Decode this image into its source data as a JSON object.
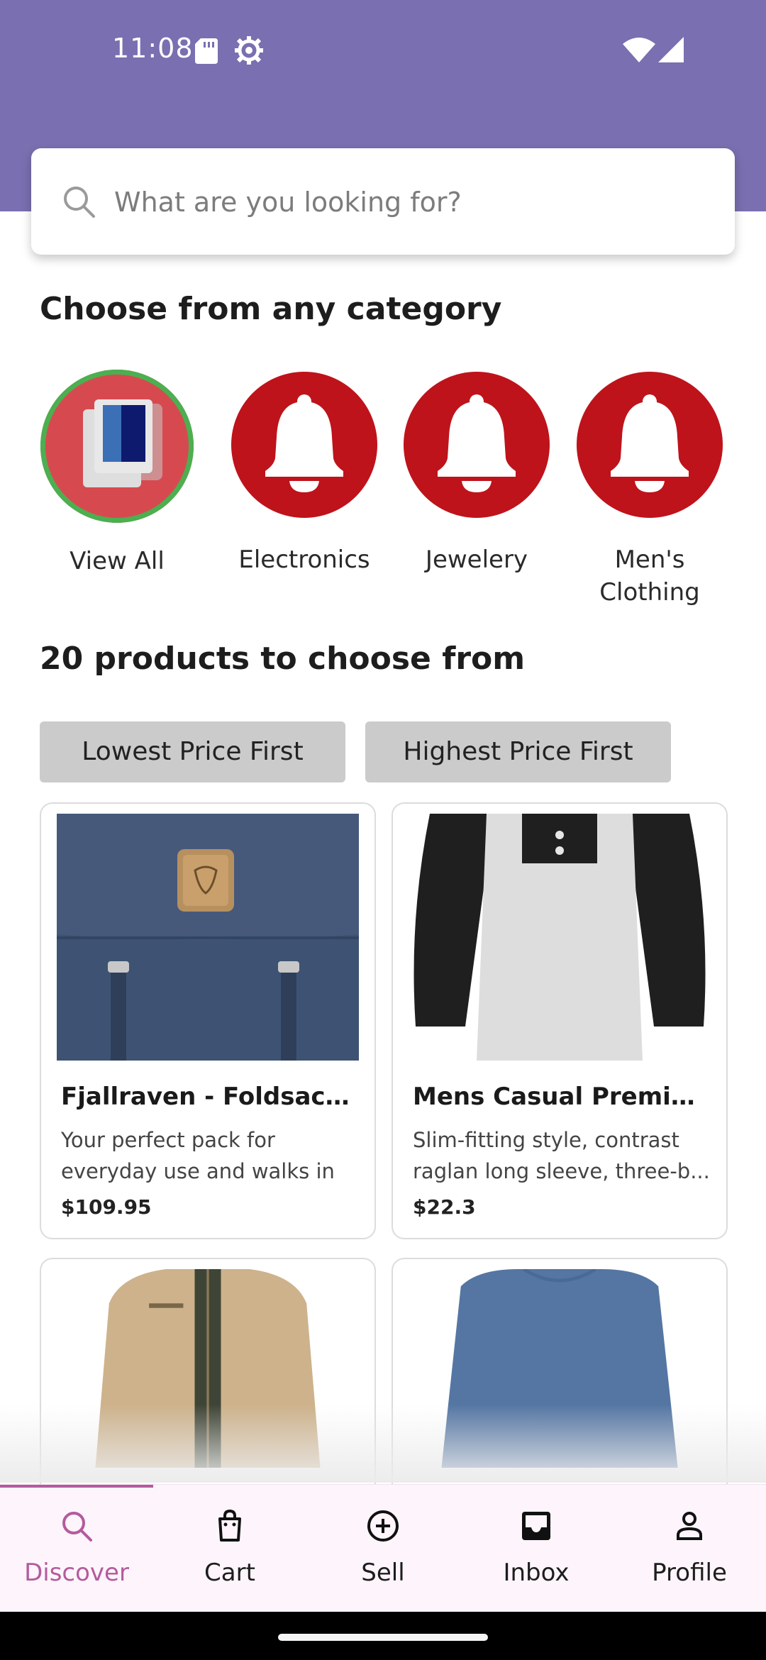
{
  "status_bar": {
    "time": "11:08"
  },
  "search": {
    "placeholder": "What are you looking for?"
  },
  "categories_section": {
    "title": "Choose from any category"
  },
  "categories": [
    {
      "label": "View All",
      "icon": "view-all-icon",
      "selected": true
    },
    {
      "label": "Electronics",
      "icon": "bell-icon",
      "selected": false
    },
    {
      "label": "Jewelery",
      "icon": "bell-icon",
      "selected": false
    },
    {
      "label": "Men's Clothing",
      "icon": "bell-icon",
      "selected": false
    }
  ],
  "products_section": {
    "title": "20 products to choose from"
  },
  "sort": {
    "lowest_label": "Lowest Price First",
    "highest_label": "Highest Price First"
  },
  "products": [
    {
      "title": "Fjallraven - Foldsack ...",
      "description": "Your perfect pack for everyday use and walks in ...",
      "price": "$109.95",
      "image": "backpack-image"
    },
    {
      "title": "Mens Casual Premiu...",
      "description": "Slim-fitting style, contrast raglan long sleeve, three-b...",
      "price": "$22.3",
      "image": "raglan-tshirt-image"
    },
    {
      "title": "",
      "description": "",
      "price": "",
      "image": "cotton-jacket-image"
    },
    {
      "title": "",
      "description": "",
      "price": "",
      "image": "slim-fit-shirt-image"
    }
  ],
  "nav": {
    "items": [
      {
        "label": "Discover",
        "icon": "search-icon",
        "active": true
      },
      {
        "label": "Cart",
        "icon": "shopping-bag-icon",
        "active": false
      },
      {
        "label": "Sell",
        "icon": "add-circle-icon",
        "active": false
      },
      {
        "label": "Inbox",
        "icon": "inbox-icon",
        "active": false
      },
      {
        "label": "Profile",
        "icon": "person-icon",
        "active": false
      }
    ]
  },
  "colors": {
    "header": "#7a6fb0",
    "category_red": "#be131b",
    "selected_ring": "#4caf50",
    "nav_active": "#b45b9e"
  }
}
